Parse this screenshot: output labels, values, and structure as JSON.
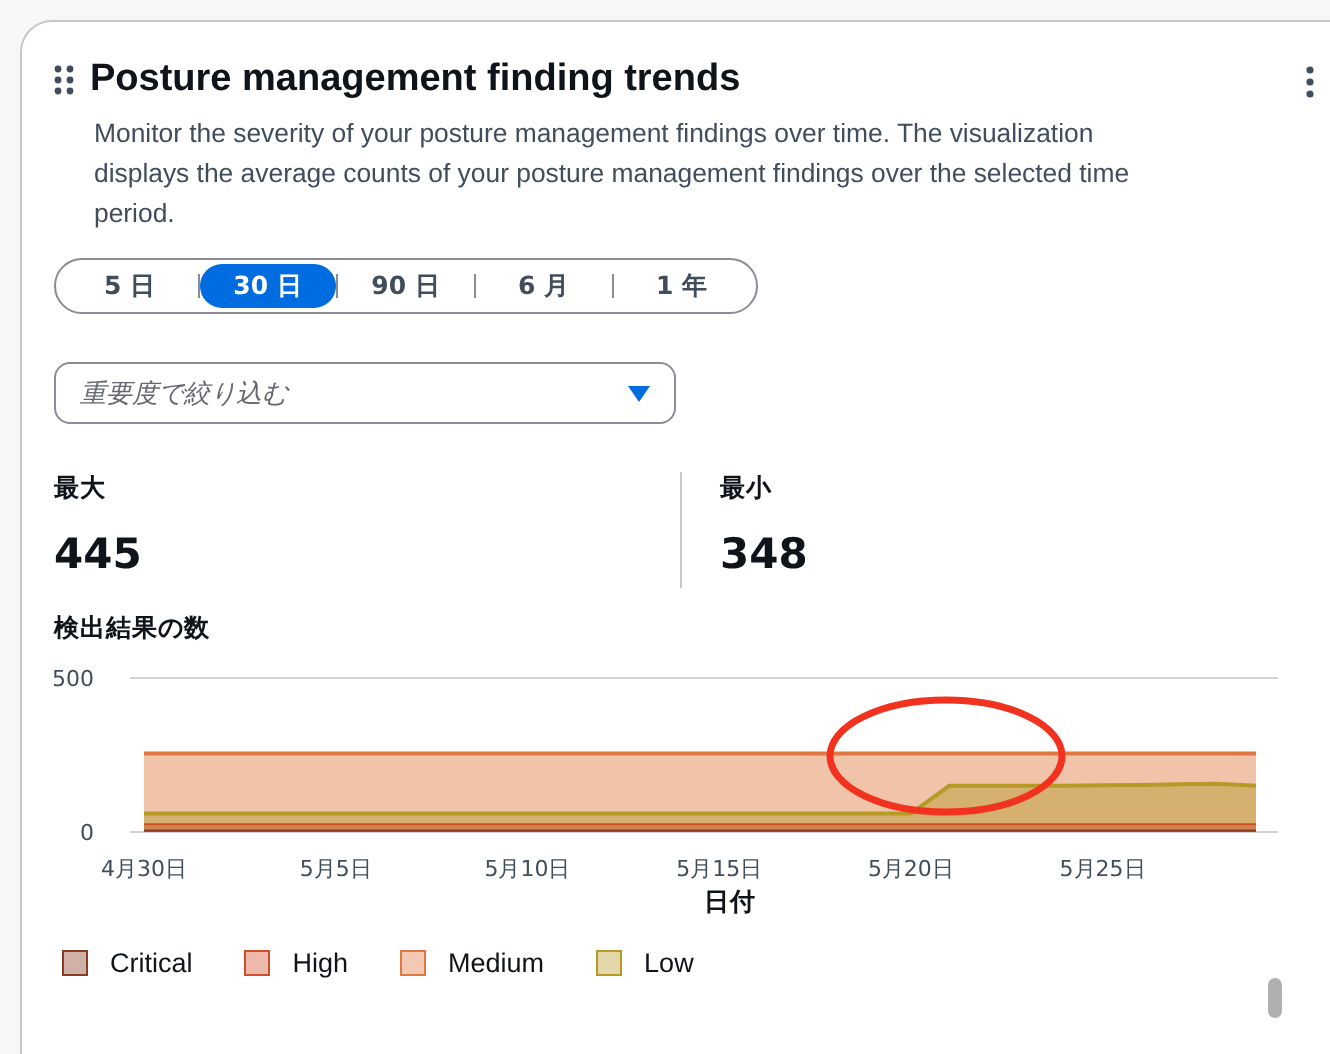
{
  "card": {
    "title": "Posture management finding trends",
    "description": "Monitor the severity of your posture management findings over time. The visualization displays the average counts of your posture management findings over the selected time period."
  },
  "ranges": [
    {
      "label": "5 日",
      "selected": false
    },
    {
      "label": "30 日",
      "selected": true
    },
    {
      "label": "90 日",
      "selected": false
    },
    {
      "label": "6 月",
      "selected": false
    },
    {
      "label": "1 年",
      "selected": false
    }
  ],
  "filter": {
    "placeholder": "重要度で絞り込む"
  },
  "stats": [
    {
      "label": "最大",
      "value": "445"
    },
    {
      "label": "最小",
      "value": "348"
    }
  ],
  "chart_title": "検出結果の数",
  "chart_data": {
    "type": "area",
    "xlabel": "日付",
    "stacked": false,
    "categories": [
      "4月30日",
      null,
      null,
      null,
      null,
      "5月5日",
      null,
      null,
      null,
      null,
      "5月10日",
      null,
      null,
      null,
      null,
      "5月15日",
      null,
      null,
      null,
      null,
      "5月20日",
      null,
      null,
      null,
      null,
      "5月25日",
      null,
      null,
      null,
      null
    ],
    "yticks": [
      0,
      500
    ],
    "ylim": [
      0,
      500
    ],
    "series": [
      {
        "name": "Critical",
        "color": "#8a3b22",
        "values": [
          5,
          5,
          5,
          5,
          5,
          5,
          5,
          5,
          5,
          5,
          5,
          5,
          5,
          5,
          5,
          5,
          5,
          5,
          5,
          5,
          5,
          5,
          5,
          5,
          5,
          5,
          5,
          5,
          5,
          5
        ]
      },
      {
        "name": "High",
        "color": "#d04f2a",
        "values": [
          25,
          25,
          25,
          25,
          25,
          25,
          25,
          25,
          25,
          25,
          25,
          25,
          25,
          25,
          25,
          25,
          25,
          25,
          25,
          25,
          25,
          25,
          25,
          25,
          25,
          25,
          25,
          25,
          25,
          25
        ]
      },
      {
        "name": "Medium",
        "color": "#e07941",
        "values": [
          255,
          255,
          255,
          255,
          255,
          255,
          255,
          255,
          255,
          255,
          255,
          255,
          255,
          255,
          255,
          255,
          255,
          255,
          255,
          255,
          255,
          255,
          255,
          255,
          255,
          255,
          255,
          255,
          255,
          255
        ]
      },
      {
        "name": "Low",
        "color": "#b59a26",
        "values": [
          60,
          60,
          60,
          60,
          60,
          60,
          60,
          60,
          60,
          60,
          60,
          60,
          60,
          60,
          60,
          60,
          60,
          60,
          60,
          60,
          60,
          150,
          150,
          150,
          150,
          152,
          153,
          155,
          157,
          150
        ]
      }
    ]
  }
}
